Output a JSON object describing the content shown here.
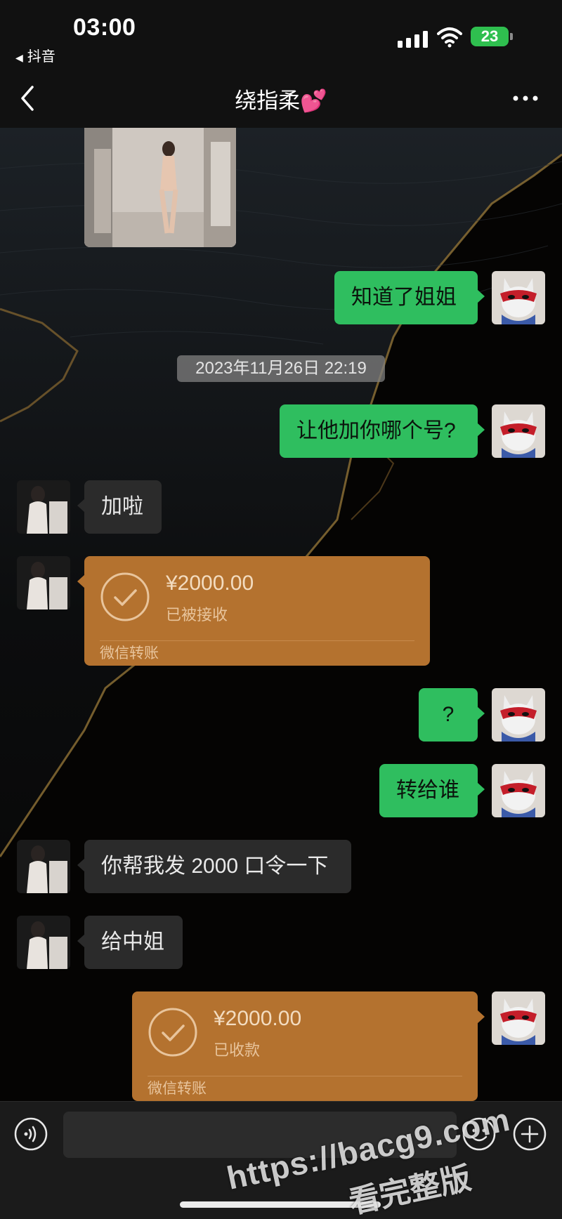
{
  "status_bar": {
    "time": "03:00",
    "back_app": "抖音",
    "battery": "23"
  },
  "header": {
    "title": "绕指柔💕"
  },
  "messages": {
    "m1": "知道了姐姐",
    "timestamp": "2023年11月26日 22:19",
    "m2": "让他加你哪个号?",
    "m3": "加啦",
    "transfer1": {
      "amount": "¥2000.00",
      "status": "已被接收",
      "label": "微信转账"
    },
    "m4": "?",
    "m5": "转给谁",
    "m6": "你帮我发 2000 口令一下",
    "m7": "给中姐",
    "transfer2": {
      "amount": "¥2000.00",
      "status": "已收款",
      "label": "微信转账"
    }
  },
  "input_bar": {
    "value": ""
  },
  "watermark": {
    "url": "https://bacg9.com",
    "text": "看完整版"
  },
  "colors": {
    "sent_bubble": "#2fbe5f",
    "received_bubble": "#2b2b2b",
    "transfer_card": "#b4722f",
    "background": "#050505"
  }
}
